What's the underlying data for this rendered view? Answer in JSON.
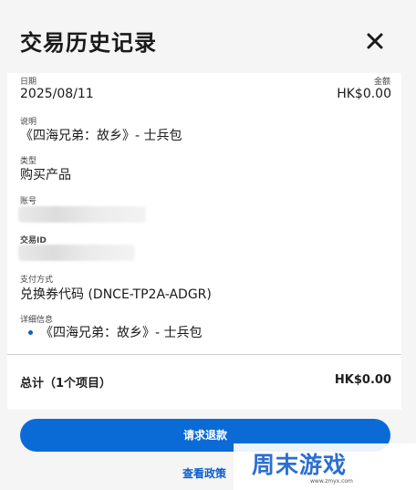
{
  "header": {
    "title": "交易历史记录"
  },
  "fields": {
    "date_label": "日期",
    "date_value": "2025/08/11",
    "amount_label": "金额",
    "amount_value": "HK$0.00",
    "desc_label": "说明",
    "desc_value": "《四海兄弟：故乡》- 士兵包",
    "type_label": "类型",
    "type_value": "购买产品",
    "account_label": "账号",
    "txid_label": "交易ID",
    "payment_label": "支付方式",
    "payment_value": "兑换券代码 (DNCE-TP2A-ADGR)",
    "details_label": "详细信息",
    "details_items": [
      "《四海兄弟：故乡》- 士兵包"
    ]
  },
  "total": {
    "label": "总计（1个项目）",
    "value": "HK$0.00"
  },
  "actions": {
    "refund_label": "请求退款",
    "policy_label": "查看政策"
  },
  "watermark": {
    "text": "周末游戏",
    "url": "www.zmyx.com"
  },
  "colors": {
    "accent": "#0b6bd6",
    "link": "#0b5fcc"
  },
  "icons": {
    "close": "close-icon"
  }
}
